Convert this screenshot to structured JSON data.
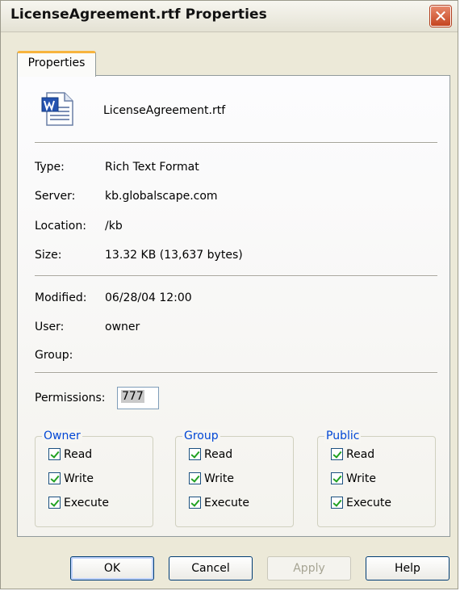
{
  "window": {
    "title": "LicenseAgreement.rtf Properties",
    "close_glyph": "✕"
  },
  "tab": {
    "label": "Properties"
  },
  "file": {
    "name": "LicenseAgreement.rtf",
    "icon": "word-document-icon"
  },
  "info": [
    {
      "label": "Type:",
      "value": "Rich Text Format"
    },
    {
      "label": "Server:",
      "value": "kb.globalscape.com"
    },
    {
      "label": "Location:",
      "value": "/kb"
    },
    {
      "label": "Size:",
      "value": "13.32 KB (13,637 bytes)"
    }
  ],
  "meta": [
    {
      "label": "Modified:",
      "value": "06/28/04 12:00"
    },
    {
      "label": "User:",
      "value": "owner"
    },
    {
      "label": "Group:",
      "value": ""
    }
  ],
  "permissions": {
    "label": "Permissions:",
    "value": "777",
    "groups": [
      {
        "title": "Owner",
        "items": [
          {
            "label": "Read",
            "checked": true
          },
          {
            "label": "Write",
            "checked": true
          },
          {
            "label": "Execute",
            "checked": true
          }
        ]
      },
      {
        "title": "Group",
        "items": [
          {
            "label": "Read",
            "checked": true
          },
          {
            "label": "Write",
            "checked": true
          },
          {
            "label": "Execute",
            "checked": true
          }
        ]
      },
      {
        "title": "Public",
        "items": [
          {
            "label": "Read",
            "checked": true
          },
          {
            "label": "Write",
            "checked": true
          },
          {
            "label": "Execute",
            "checked": true
          }
        ]
      }
    ]
  },
  "buttons": {
    "ok": "OK",
    "cancel": "Cancel",
    "apply": "Apply",
    "help": "Help"
  },
  "colors": {
    "accent": "#0046d5",
    "tab_highlight": "#f7b43d",
    "close": "#c5441f"
  }
}
